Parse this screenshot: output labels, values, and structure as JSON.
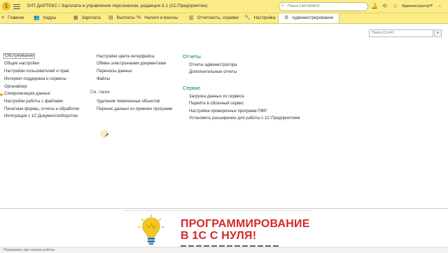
{
  "titlebar": {
    "title": "ЗУП ДАРТЕКС / Зарплата и управление персоналом, редакция 3.1  (1С:Предприятие)",
    "search_placeholder": "Поиск Ctrl+Shift+F",
    "user": "Администратор"
  },
  "sections": [
    {
      "label": "Главное",
      "icon": "home-icon"
    },
    {
      "label": "Кадры",
      "icon": "people-icon"
    },
    {
      "label": "Зарплата",
      "icon": "salary-icon"
    },
    {
      "label": "Выплаты",
      "icon": "payments-icon"
    },
    {
      "label": "Налоги и взносы",
      "icon": "percent-icon"
    },
    {
      "label": "Отчетность, справки",
      "icon": "chart-icon"
    },
    {
      "label": "Настройка",
      "icon": "wrench-icon"
    },
    {
      "label": "Администрирование",
      "icon": "gear-icon"
    }
  ],
  "active_section": "Администрирование",
  "content_search_placeholder": "Поиск (Ctrl+F)",
  "col1": [
    "Обслуживание",
    "Общие настройки",
    "Настройки пользователей и прав",
    "Интернет-поддержка и сервисы",
    "Органайзер",
    "Синхронизация данных",
    "Настройки работы с файлами",
    "Печатные формы, отчеты и обработки",
    "Интеграция с 1С:Документооборотом"
  ],
  "col2": [
    "Настройки цвета интерфейса",
    "Обмен электронными документами",
    "Переносы данных",
    "Файлы"
  ],
  "see_also": {
    "heading": "См. также",
    "items": [
      "Удаление помеченных объектов",
      "Перенос данных из прежних программ"
    ]
  },
  "reports": {
    "heading": "Отчеты",
    "items": [
      "Отчеты администратора",
      "Дополнительные отчеты"
    ]
  },
  "service": {
    "heading": "Сервис",
    "items": [
      "Загрузка данных из сервиса",
      "Перейти в облачный сервис",
      "Настройка проверочных программ ПФР",
      "Установить расширение для работы с 1С:Предприятием"
    ]
  },
  "banner": {
    "line1": "ПРОГРАММИРОВАНИЕ",
    "line2": "В 1С С НУЛЯ!"
  },
  "status_text": "Показывать при начале работы",
  "colors": {
    "titlebar_bg": "#fbec88",
    "heading_green": "#1a7a52",
    "banner_red": "#d3292b"
  }
}
